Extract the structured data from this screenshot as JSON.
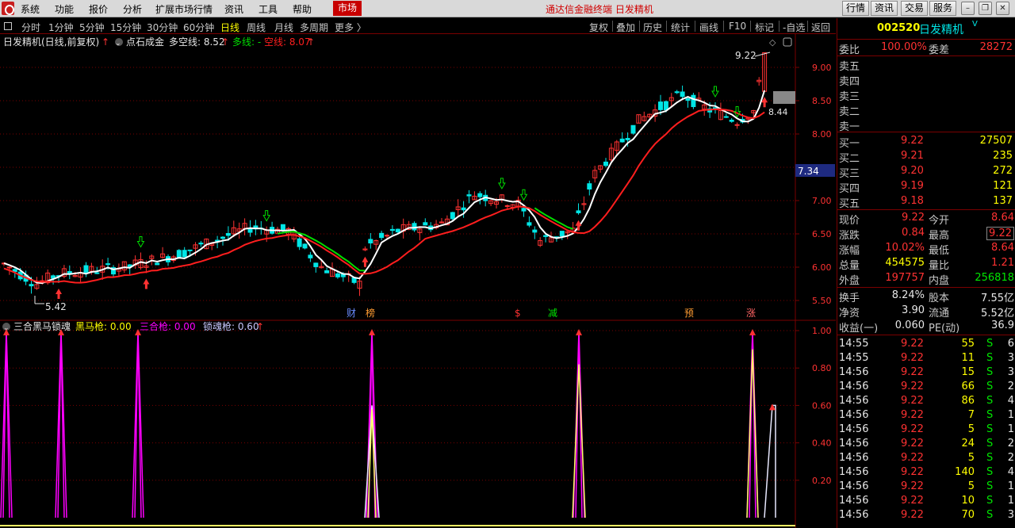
{
  "menu": {
    "items": [
      "系统",
      "功能",
      "报价",
      "分析",
      "扩展市场行情",
      "资讯",
      "工具",
      "帮助"
    ],
    "market_tab": "市场",
    "brand_title": "通达信金融终端  日发精机",
    "right_buttons": [
      "行情",
      "资讯",
      "交易",
      "服务"
    ]
  },
  "toolbar": {
    "periods": [
      "分时",
      "1分钟",
      "5分钟",
      "15分钟",
      "30分钟",
      "60分钟",
      "日线",
      "周线",
      "月线",
      "多周期",
      "更多 〉"
    ],
    "active_period": "日线",
    "right_items": [
      "复权",
      "叠加",
      "历史",
      "统计",
      "画线",
      "F10",
      "标记",
      "-自选",
      "返回"
    ]
  },
  "chart": {
    "header_title": "日发精机(日线,前复权)",
    "indicator_name": "点石成金",
    "indicator_short": "多空线: 8.52",
    "indicator_long_label": "多线: -",
    "indicator_empty_label": "空线: 8.07",
    "y_ticks": [
      "9.00",
      "8.50",
      "8.00",
      "7.50",
      "7.00",
      "6.50",
      "6.00",
      "5.50"
    ],
    "price_tag": "7.34",
    "high_label": "9.22",
    "low_label": "5.42",
    "cur_label": "8.44",
    "markers": [
      {
        "text": "财",
        "color": "#6a8cff"
      },
      {
        "text": "榜",
        "color": "#ff9c32"
      },
      {
        "text": "$",
        "color": "#ff3232"
      },
      {
        "text": "减",
        "color": "#00e600"
      },
      {
        "text": "预",
        "color": "#ff9c32"
      },
      {
        "text": "涨",
        "color": "#ff6464"
      }
    ],
    "sub_title": "三合黑马锁魂",
    "sub_horse": "黑马枪: 0.00",
    "sub_three": "三合枪: 0.00",
    "sub_lock": "锁魂枪: 0.60",
    "sub_ticks": [
      "1.00",
      "0.80",
      "0.60",
      "0.40",
      "0.20"
    ]
  },
  "stock": {
    "code": "002520",
    "name": "日发精机",
    "suffix": "V"
  },
  "order_book": {
    "wei_bi_label": "委比",
    "wei_bi": "100.00%",
    "wei_cha_label": "委差",
    "wei_cha": "28272",
    "asks": [
      {
        "label": "卖五",
        "price": "",
        "vol": ""
      },
      {
        "label": "卖四",
        "price": "",
        "vol": ""
      },
      {
        "label": "卖三",
        "price": "",
        "vol": ""
      },
      {
        "label": "卖二",
        "price": "",
        "vol": ""
      },
      {
        "label": "卖一",
        "price": "",
        "vol": ""
      }
    ],
    "bids": [
      {
        "label": "买一",
        "price": "9.22",
        "vol": "27507"
      },
      {
        "label": "买二",
        "price": "9.21",
        "vol": "235"
      },
      {
        "label": "买三",
        "price": "9.20",
        "vol": "272"
      },
      {
        "label": "买四",
        "price": "9.19",
        "vol": "121"
      },
      {
        "label": "买五",
        "price": "9.18",
        "vol": "137"
      }
    ]
  },
  "quote": [
    {
      "l1": "现价",
      "v1": "9.22",
      "c1": "red",
      "l2": "今开",
      "v2": "8.64",
      "c2": "red"
    },
    {
      "l1": "涨跌",
      "v1": "0.84",
      "c1": "red",
      "l2": "最高",
      "v2": "9.22",
      "c2": "red"
    },
    {
      "l1": "涨幅",
      "v1": "10.02%",
      "c1": "red",
      "l2": "最低",
      "v2": "8.64",
      "c2": "red"
    },
    {
      "l1": "总量",
      "v1": "454575",
      "c1": "yellow",
      "l2": "量比",
      "v2": "1.21",
      "c2": "red"
    },
    {
      "l1": "外盘",
      "v1": "197757",
      "c1": "red",
      "l2": "内盘",
      "v2": "256818",
      "c2": "green"
    },
    {
      "l1": "换手",
      "v1": "8.24%",
      "c1": "white",
      "l2": "股本",
      "v2": "7.55亿",
      "c2": "white"
    },
    {
      "l1": "净资",
      "v1": "3.90",
      "c1": "white",
      "l2": "流通",
      "v2": "5.52亿",
      "c2": "white"
    },
    {
      "l1": "收益(一)",
      "v1": "0.060",
      "c1": "white",
      "l2": "PE(动)",
      "v2": "36.9",
      "c2": "white"
    }
  ],
  "ticks": [
    {
      "time": "14:55",
      "price": "9.22",
      "vol": "55",
      "side": "S",
      "n": "6"
    },
    {
      "time": "14:55",
      "price": "9.22",
      "vol": "11",
      "side": "S",
      "n": "3"
    },
    {
      "time": "14:56",
      "price": "9.22",
      "vol": "15",
      "side": "S",
      "n": "3"
    },
    {
      "time": "14:56",
      "price": "9.22",
      "vol": "66",
      "side": "S",
      "n": "2"
    },
    {
      "time": "14:56",
      "price": "9.22",
      "vol": "86",
      "side": "S",
      "n": "4"
    },
    {
      "time": "14:56",
      "price": "9.22",
      "vol": "7",
      "side": "S",
      "n": "1"
    },
    {
      "time": "14:56",
      "price": "9.22",
      "vol": "5",
      "side": "S",
      "n": "1"
    },
    {
      "time": "14:56",
      "price": "9.22",
      "vol": "24",
      "side": "S",
      "n": "2"
    },
    {
      "time": "14:56",
      "price": "9.22",
      "vol": "5",
      "side": "S",
      "n": "2"
    },
    {
      "time": "14:56",
      "price": "9.22",
      "vol": "140",
      "side": "S",
      "n": "4"
    },
    {
      "time": "14:56",
      "price": "9.22",
      "vol": "5",
      "side": "S",
      "n": "1"
    },
    {
      "time": "14:56",
      "price": "9.22",
      "vol": "10",
      "side": "S",
      "n": "1"
    },
    {
      "time": "14:56",
      "price": "9.22",
      "vol": "70",
      "side": "S",
      "n": "3"
    }
  ],
  "colors": {
    "up": "#ff3232",
    "down": "#00e6e6",
    "ma_white": "#ffffff",
    "ma_red": "#ff1e1e",
    "ma_green": "#00dc00",
    "grid": "#7a0000",
    "spike_magenta": "#ff00ff",
    "spike_yellow": "#ffff64",
    "spike_white": "#e8e8ff"
  }
}
